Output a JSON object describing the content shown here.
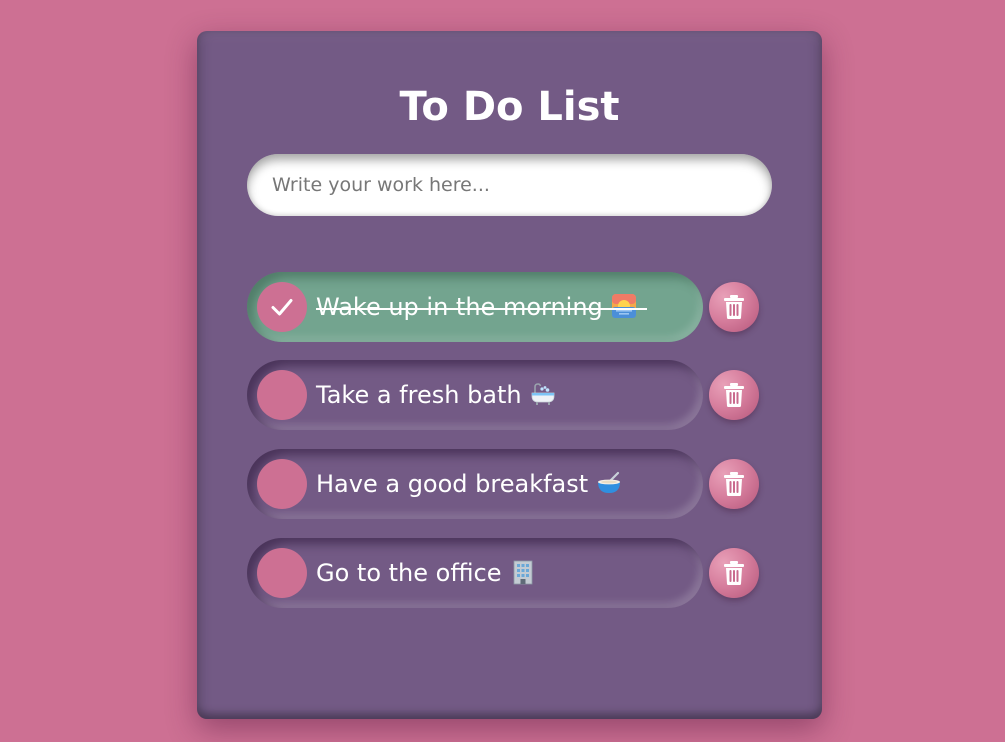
{
  "app": {
    "title": "To Do List"
  },
  "input": {
    "placeholder": "Write your work here...",
    "value": ""
  },
  "tasks": [
    {
      "text": "Wake up in the morning",
      "emoji": "sunrise-over-water-icon",
      "completed": true
    },
    {
      "text": "Take a fresh bath",
      "emoji": "bathtub-icon",
      "completed": false
    },
    {
      "text": "Have a good breakfast",
      "emoji": "bowl-with-spoon-icon",
      "completed": false
    },
    {
      "text": "Go to the office",
      "emoji": "office-building-icon",
      "completed": false
    }
  ],
  "colors": {
    "background": "#cd7093",
    "card": "#735a85",
    "completed": "#73a48f",
    "accent": "#cd7093",
    "text": "#ffffff"
  },
  "icons": {
    "delete": "trash-icon",
    "check": "checkmark-icon"
  }
}
